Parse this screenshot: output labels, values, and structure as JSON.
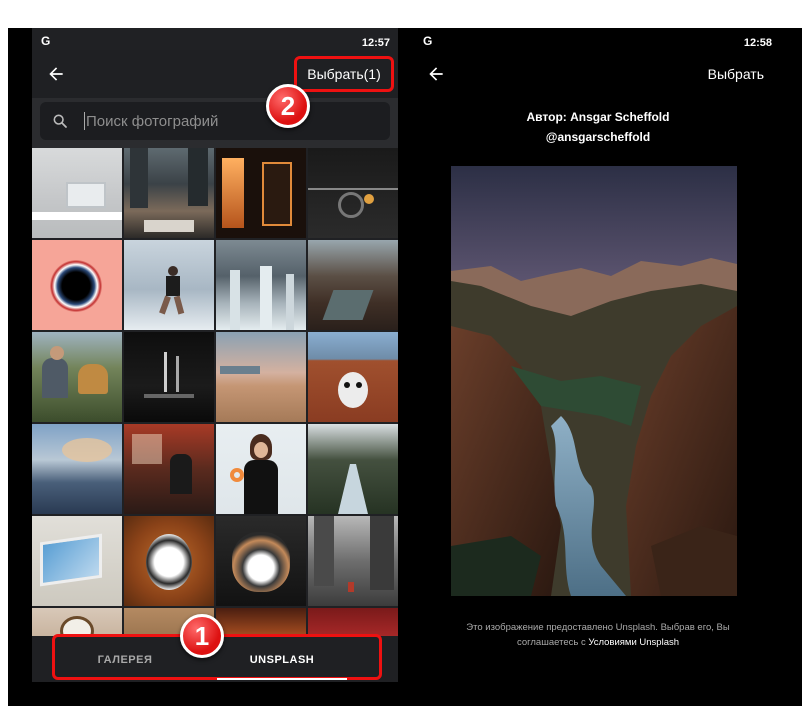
{
  "left_screen": {
    "status": {
      "carrier_icon": "G",
      "time": "12:57"
    },
    "appbar": {
      "back_icon": "arrow-left-icon",
      "select_label": "Выбрать(1)"
    },
    "search": {
      "placeholder": "Поиск фотографий",
      "icon": "search-icon"
    },
    "photos": [
      "laptop on desk",
      "busy city street",
      "illuminated clock tower",
      "bicycle on bridge",
      "swirl on pink",
      "girl dancing on ice",
      "waterfall",
      "mountain valley",
      "man with dog by lake",
      "dark stage lights",
      "city beach sunset",
      "cyclist in graffiti alley",
      "mountain clouds",
      "man in cafe window",
      "woman with donut",
      "forest river",
      "laptop blue screen",
      "dog in autumn leaves",
      "dog portrait",
      "rainy city street",
      "coffee cup",
      "food",
      "orange lights",
      "red flowers"
    ],
    "tabs": [
      {
        "label": "ГАЛЕРЕЯ",
        "active": false
      },
      {
        "label": "UNSPLASH",
        "active": true
      }
    ]
  },
  "right_screen": {
    "status": {
      "carrier_icon": "G",
      "time": "12:58"
    },
    "appbar": {
      "back_icon": "arrow-left-icon",
      "select_label": "Выбрать"
    },
    "author_line": "Автор: Ansgar Scheffold",
    "author_handle": "@ansgarscheffold",
    "photo_alt": "canyon with river at dusk",
    "legal_text": "Это изображение предоставлено Unsplash. Выбрав его, Вы соглашаетесь с",
    "legal_link": "Условиями Unsplash"
  },
  "annotations": {
    "badge_1": "1",
    "badge_2": "2"
  },
  "colors": {
    "highlight": "#e11111",
    "panel_bg": "#202124",
    "appbar_bg": "#1f2023"
  }
}
